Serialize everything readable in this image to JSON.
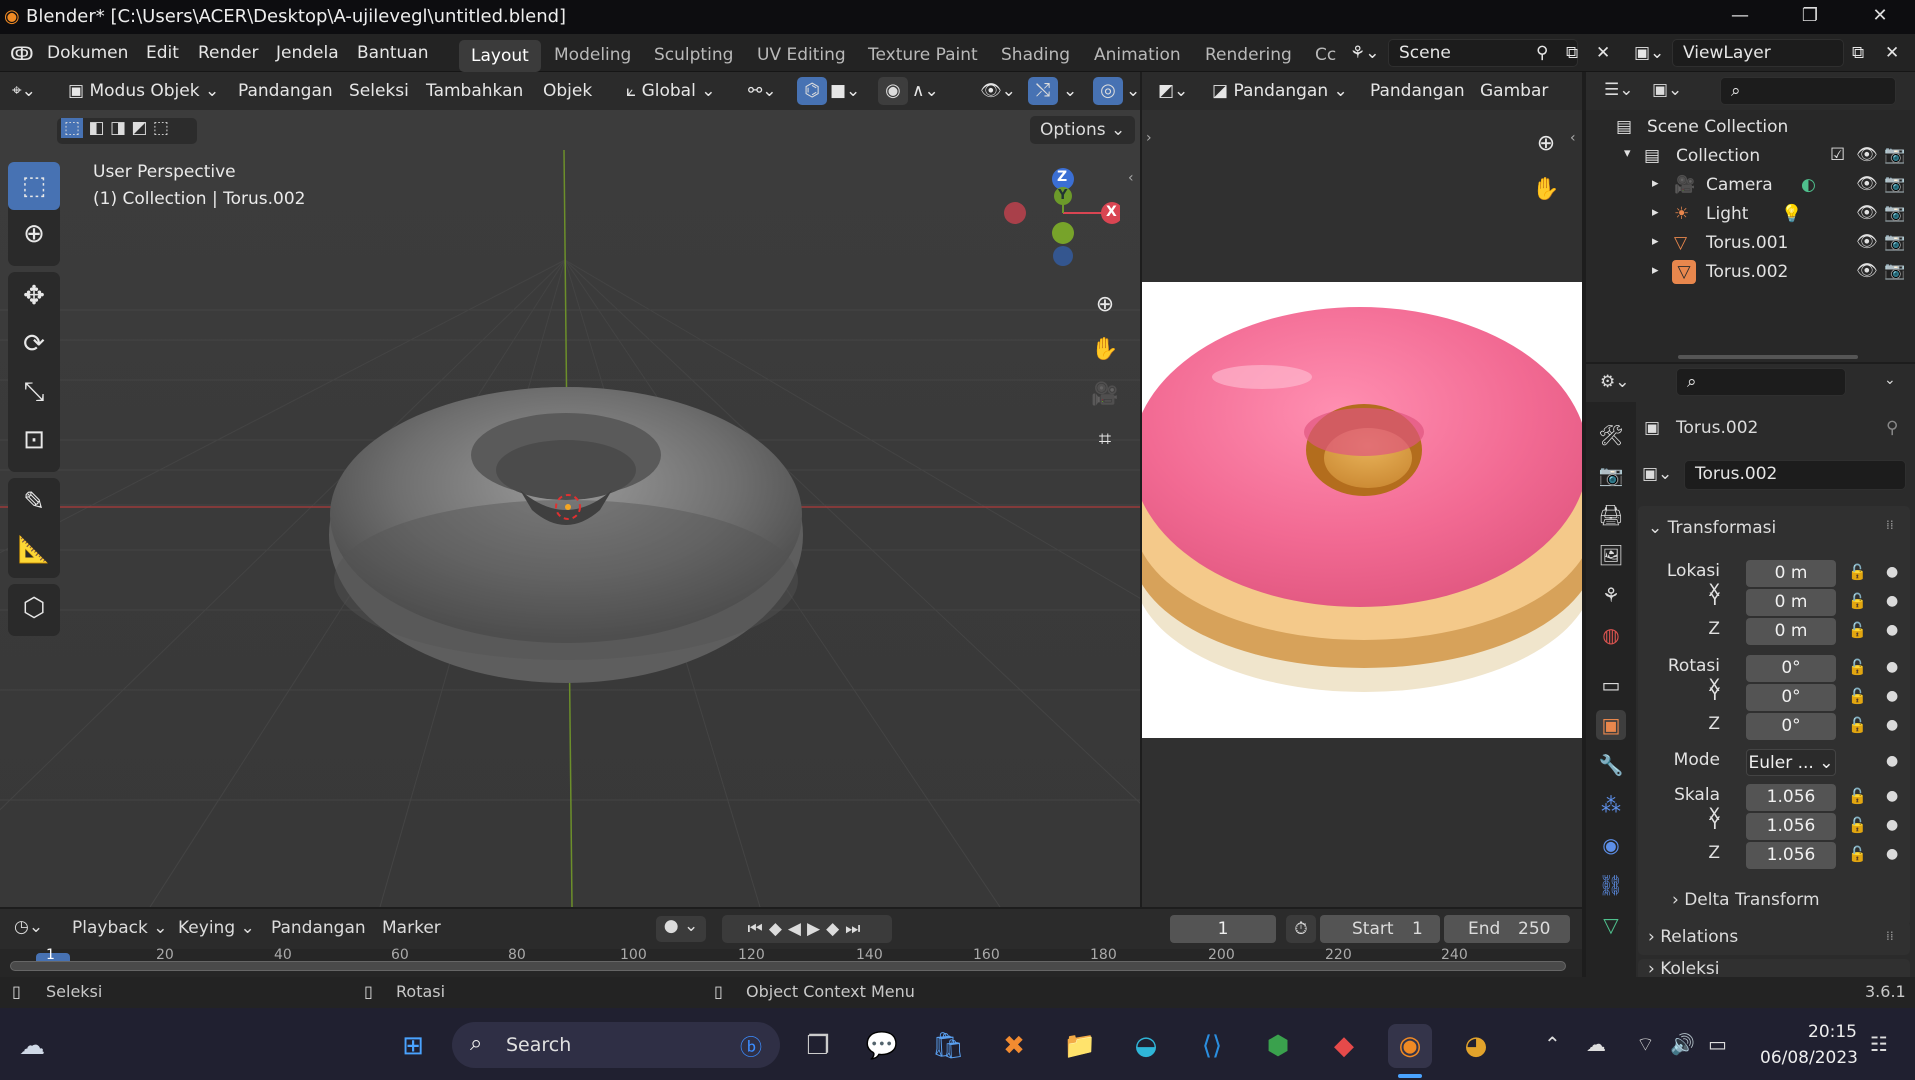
{
  "titlebar": {
    "title": "Blender* [C:\\Users\\ACER\\Desktop\\A-ujilevegl\\untitled.blend]"
  },
  "menu": {
    "items": [
      "Dokumen",
      "Edit",
      "Render",
      "Jendela",
      "Bantuan"
    ]
  },
  "workspaces": [
    "Layout",
    "Modeling",
    "Sculpting",
    "UV Editing",
    "Texture Paint",
    "Shading",
    "Animation",
    "Rendering",
    "Cc"
  ],
  "scene": {
    "name": "Scene",
    "viewlayer": "ViewLayer"
  },
  "viewport_header": {
    "mode": "Modus Objek",
    "items": [
      "Pandangan",
      "Seleksi",
      "Tambahkan",
      "Objek"
    ],
    "orientation": "Global",
    "options": "Options"
  },
  "viewport": {
    "perspective": "User Perspective",
    "collection_info": "(1) Collection | Torus.002",
    "gizmo": {
      "z": "Z",
      "y": "Y",
      "x": "X"
    }
  },
  "image_editor": {
    "view_label": "Pandangan",
    "items": [
      "Pandangan",
      "Gambar"
    ]
  },
  "outliner": {
    "scene_collection": "Scene Collection",
    "collection": "Collection",
    "items": [
      "Camera",
      "Light",
      "Torus.001",
      "Torus.002"
    ]
  },
  "properties": {
    "object_name": "Torus.002",
    "data_name": "Torus.002",
    "panel": "Transformasi",
    "location_label": "Lokasi X",
    "rotation_label": "Rotasi X",
    "scale_label": "Skala X",
    "y": "Y",
    "z": "Z",
    "location": [
      "0 m",
      "0 m",
      "0 m"
    ],
    "rotation": [
      "0°",
      "0°",
      "0°"
    ],
    "mode_label": "Mode",
    "mode_value": "Euler ...",
    "scale": [
      "1.056",
      "1.056",
      "1.056"
    ],
    "delta": "Delta Transform",
    "relations": "Relations",
    "koleksi": "Koleksi"
  },
  "timeline": {
    "items": [
      "Playback",
      "Keying",
      "Pandangan",
      "Marker"
    ],
    "current_frame": "1",
    "start_label": "Start",
    "start": "1",
    "end_label": "End",
    "end": "250",
    "ruler": [
      "1",
      "20",
      "40",
      "60",
      "80",
      "100",
      "120",
      "140",
      "160",
      "180",
      "200",
      "220",
      "240"
    ]
  },
  "statusbar": {
    "select": "Seleksi",
    "rotate": "Rotasi",
    "context": "Object Context Menu",
    "version": "3.6.1"
  },
  "taskbar": {
    "search": "Search",
    "time": "20:15",
    "date": "06/08/2023"
  }
}
